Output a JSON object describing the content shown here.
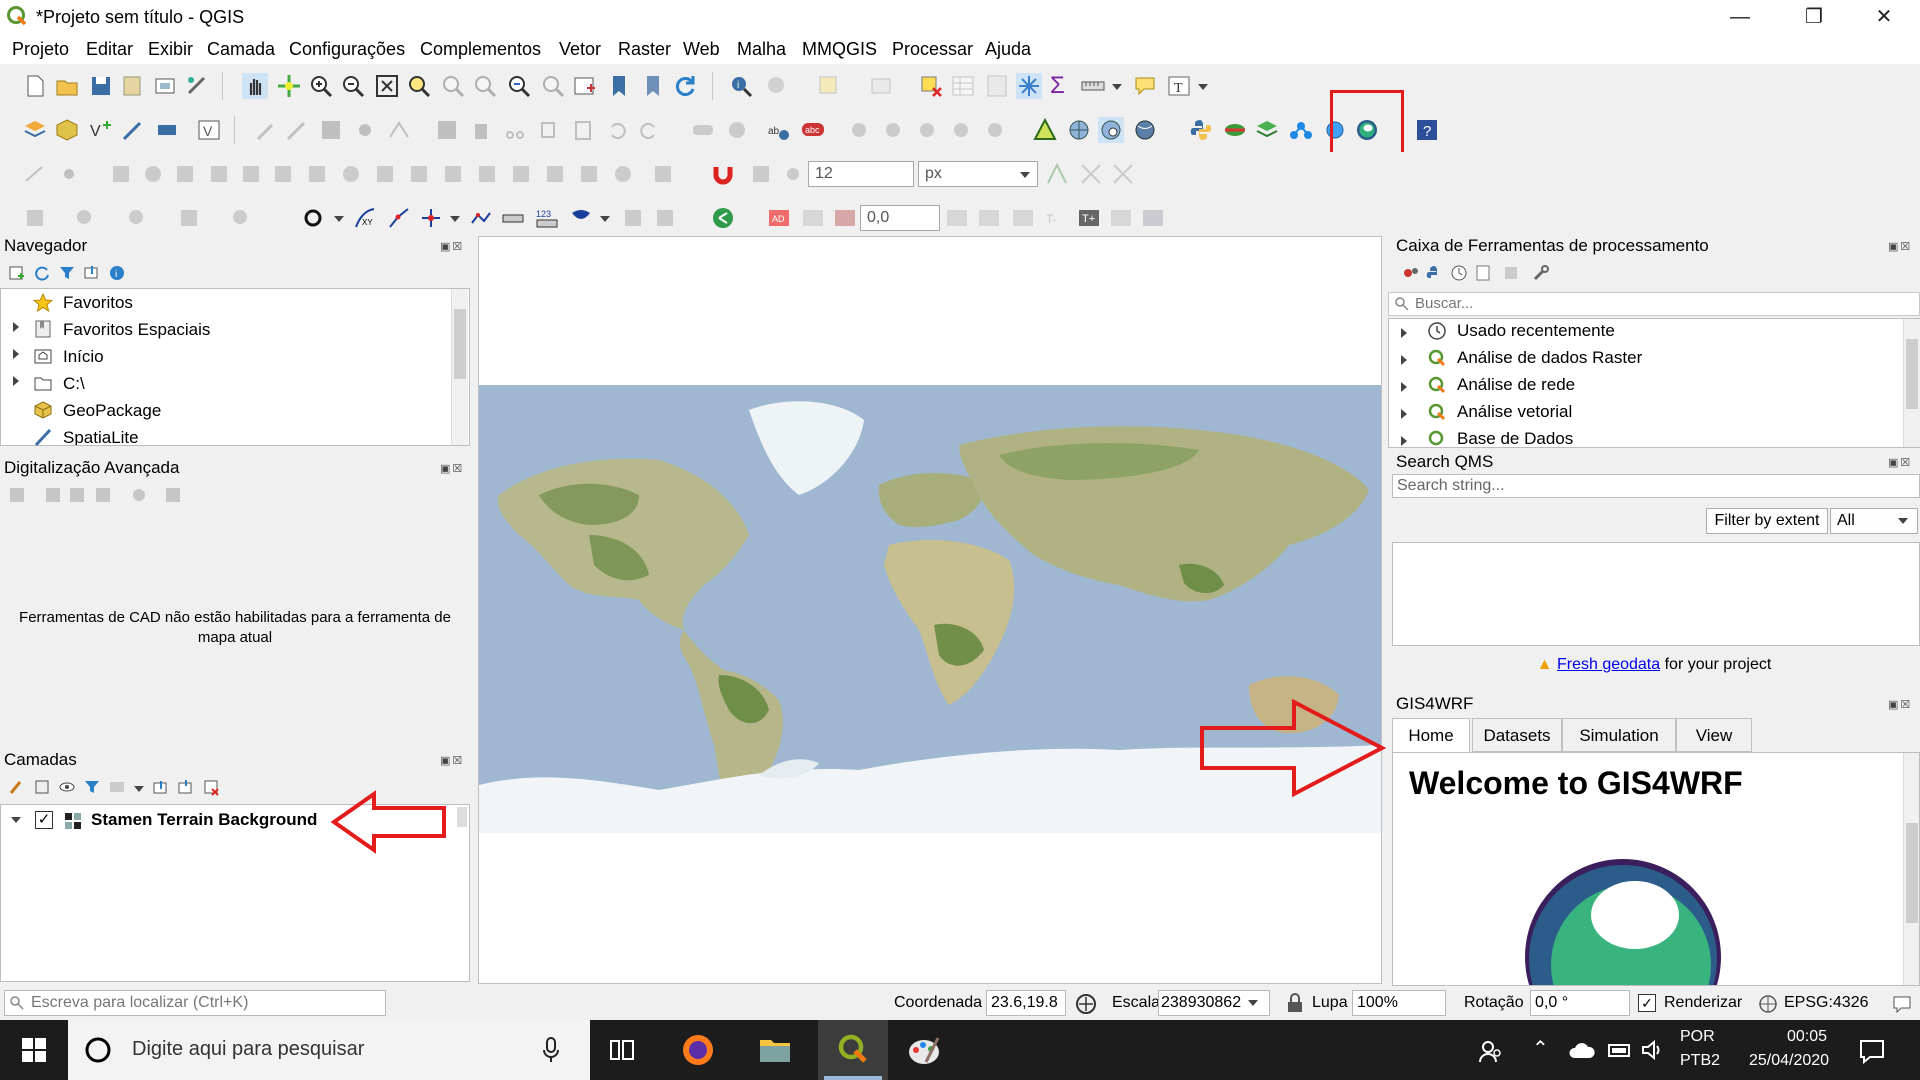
{
  "window": {
    "title": "*Projeto sem título - QGIS"
  },
  "menu": [
    "Projeto",
    "Editar",
    "Exibir",
    "Camada",
    "Configurações",
    "Complementos",
    "Vetor",
    "Raster",
    "Web",
    "Malha",
    "MMQGIS",
    "Processar",
    "Ajuda"
  ],
  "toolbar": {
    "font_size_value": "12",
    "unit_value": "px",
    "offset_value": "0,0"
  },
  "browser": {
    "title": "Navegador",
    "items": [
      {
        "label": "Favoritos",
        "icon": "star-icon"
      },
      {
        "label": "Favoritos Espaciais",
        "icon": "bookmark-icon"
      },
      {
        "label": "Início",
        "icon": "home-folder-icon"
      },
      {
        "label": "C:\\",
        "icon": "folder-icon"
      },
      {
        "label": "GeoPackage",
        "icon": "geopackage-icon"
      },
      {
        "label": "SpatiaLite",
        "icon": "spatialite-icon"
      }
    ]
  },
  "advanced_digitizing": {
    "title": "Digitalização Avançada",
    "message_line1": "Ferramentas de CAD não estão habilitadas para a ferramenta de",
    "message_line2": "mapa atual"
  },
  "layers": {
    "title": "Camadas",
    "items": [
      {
        "label": "Stamen Terrain Background",
        "checked": true
      }
    ]
  },
  "processing": {
    "title": "Caixa de Ferramentas de processamento",
    "search_placeholder": "Buscar...",
    "items": [
      "Usado recentemente",
      "Análise de dados Raster",
      "Análise de rede",
      "Análise vetorial",
      "Base de Dados"
    ]
  },
  "qms": {
    "title": "Search QMS",
    "search_placeholder": "Search string...",
    "filter_button": "Filter by extent",
    "filter_select": "All",
    "fresh_link": "Fresh geodata",
    "fresh_suffix": " for your project"
  },
  "gis4wrf": {
    "title": "GIS4WRF",
    "tabs": [
      "Home",
      "Datasets",
      "Simulation",
      "View"
    ],
    "active_tab": "Home",
    "welcome": "Welcome to GIS4WRF"
  },
  "statusbar": {
    "locate_placeholder": "Escreva para localizar (Ctrl+K)",
    "coord_label": "Coordenada",
    "coord_value": "23.6,19.8",
    "scale_label": "Escala",
    "scale_value": "238930862",
    "magnifier_label": "Lupa",
    "magnifier_value": "100%",
    "rotation_label": "Rotação",
    "rotation_value": "0,0 °",
    "render_label": "Renderizar",
    "crs": "EPSG:4326"
  },
  "taskbar": {
    "search_placeholder": "Digite aqui para pesquisar",
    "lang": "POR",
    "layout": "PTB2",
    "time": "00:05",
    "date": "25/04/2020"
  },
  "colors": {
    "highlight_red": "#e31b1b",
    "ocean": "#9fb7d1",
    "link": "#0000ee"
  }
}
